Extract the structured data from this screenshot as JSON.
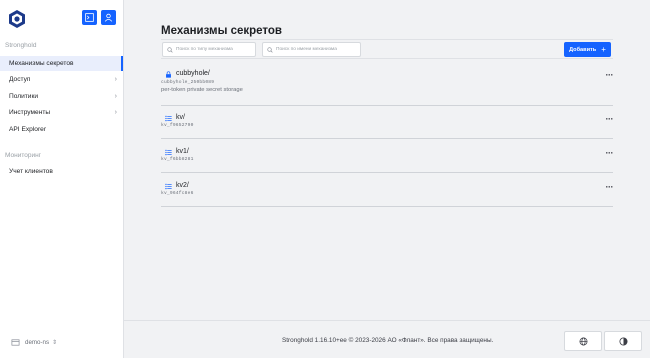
{
  "sidebar": {
    "section_stronghold": "Stronghold",
    "items": [
      {
        "label": "Механизмы секретов",
        "active": true,
        "chevron": false
      },
      {
        "label": "Доступ",
        "active": false,
        "chevron": true
      },
      {
        "label": "Политики",
        "active": false,
        "chevron": true
      },
      {
        "label": "Инструменты",
        "active": false,
        "chevron": true
      },
      {
        "label": "API Explorer",
        "active": false,
        "chevron": false
      }
    ],
    "section_monitoring": "Мониторинг",
    "monitoring_items": [
      {
        "label": "Учет клиентов"
      }
    ],
    "namespace": "demo-ns",
    "namespace_arrow": "⇕"
  },
  "header_buttons": {
    "console_icon": "terminal-icon",
    "user_icon": "user-icon"
  },
  "main": {
    "title": "Механизмы секретов",
    "search_type_placeholder": "Поиск по типу механизма",
    "search_name_placeholder": "Поиск по имени механизма",
    "add_label": "Добавить",
    "add_plus": "+",
    "engines": [
      {
        "name": "cubbyhole/",
        "accessor": "cubbyhole_250bb089",
        "description": "per-token private secret storage",
        "icon": "lock-icon"
      },
      {
        "name": "kv/",
        "accessor": "kv_f9652790",
        "description": "",
        "icon": "list-icon"
      },
      {
        "name": "kv1/",
        "accessor": "kv_f6bb8281",
        "description": "",
        "icon": "list-icon"
      },
      {
        "name": "kv2/",
        "accessor": "kv_964fc8e6",
        "description": "",
        "icon": "list-icon"
      }
    ],
    "more_glyph": "···"
  },
  "footer": {
    "text": "Stronghold 1.16.10+ee   © 2023-2026 АО «Флант». Все права защищены.",
    "language_icon": "globe-icon",
    "theme_icon": "theme-toggle-icon"
  },
  "colors": {
    "accent": "#1563ff",
    "background": "#f1f2f4",
    "sidebar_bg": "#ffffff",
    "active_item_bg": "#e9eefc"
  }
}
